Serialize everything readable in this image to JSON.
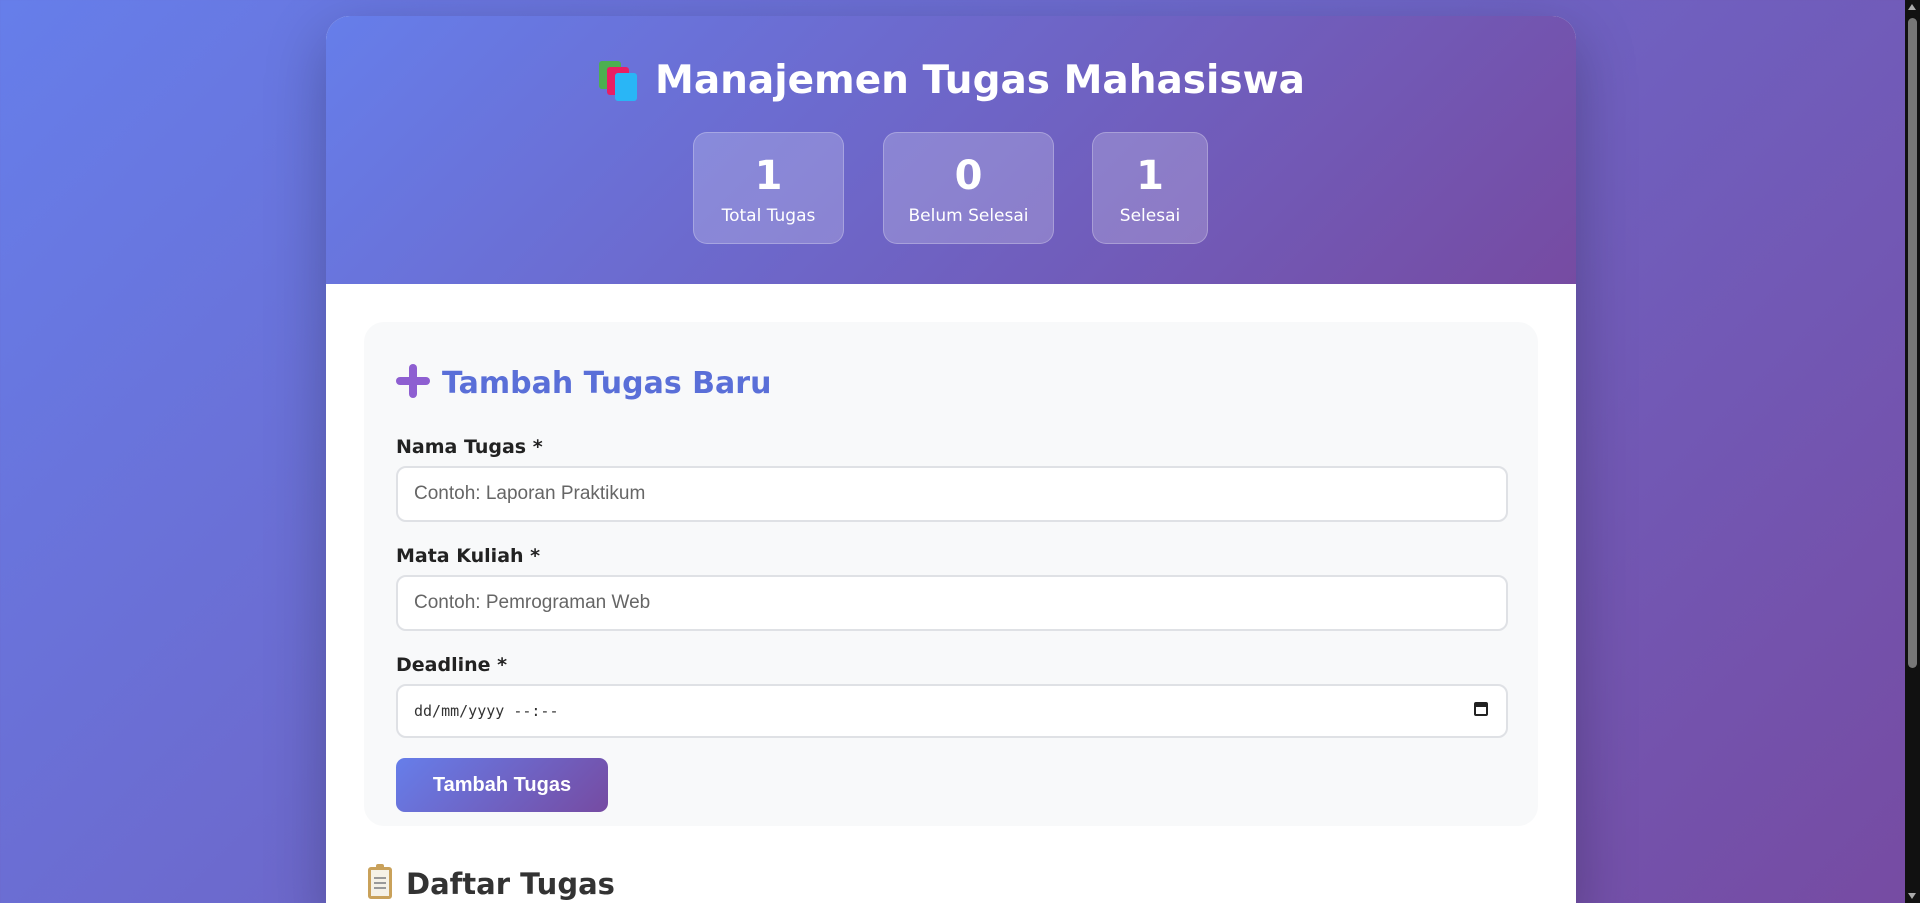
{
  "header": {
    "title": "Manajemen Tugas Mahasiswa",
    "icon": "books-icon"
  },
  "stats": [
    {
      "value": "1",
      "label": "Total Tugas"
    },
    {
      "value": "0",
      "label": "Belum Selesai"
    },
    {
      "value": "1",
      "label": "Selesai"
    }
  ],
  "form": {
    "title": "Tambah Tugas Baru",
    "icon": "plus-icon",
    "task_name": {
      "label": "Nama Tugas *",
      "placeholder": "Contoh: Laporan Praktikum",
      "value": ""
    },
    "course": {
      "label": "Mata Kuliah *",
      "placeholder": "Contoh: Pemrograman Web",
      "value": ""
    },
    "deadline": {
      "label": "Deadline *",
      "placeholder": "dd/mm/yyyy --:--"
    },
    "submit_label": "Tambah Tugas"
  },
  "task_list": {
    "title": "Daftar Tugas",
    "icon": "clipboard-icon"
  },
  "colors": {
    "gradient_start": "#667eea",
    "gradient_end": "#764ba2",
    "accent": "#5a6fd8"
  }
}
